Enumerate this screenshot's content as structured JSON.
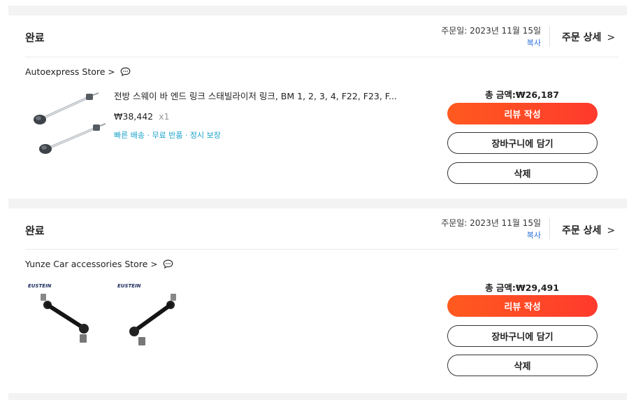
{
  "orders": [
    {
      "status": "완료",
      "order_date": "주문일: 2023년 11월 15일",
      "copy_label": "복사",
      "detail_label": "주문 상세",
      "detail_chevron": ">",
      "store_name": "Autoexpress Store",
      "store_chevron": ">",
      "product_title": "전방 스웨이 바 엔드 링크 스태빌라이저 링크, BM 1, 2, 3, 4, F22, F23, F...",
      "price": "₩38,442",
      "quantity": "x1",
      "benefits": "빠른 배송 · 무료 반품 · 정시 보장",
      "total": "총 금액:₩26,187",
      "review_label": "리뷰 작성",
      "cart_label": "장바구니에 담기",
      "delete_label": "삭제"
    },
    {
      "status": "완료",
      "order_date": "주문일: 2023년 11월 15일",
      "copy_label": "복사",
      "detail_label": "주문 상세",
      "detail_chevron": ">",
      "store_name": "Yunze Car accessories Store",
      "store_chevron": ">",
      "image_brand": "EUSTEIN",
      "total": "총 금액:₩29,491",
      "review_label": "리뷰 작성",
      "cart_label": "장바구니에 담기",
      "delete_label": "삭제"
    }
  ],
  "colors": {
    "accent": "#ff4a24",
    "link": "#2a6fdb",
    "benefit": "#1aa3c9",
    "band": "#f3f3f3"
  },
  "icons": [
    "chat-icon",
    "chevron-right-icon"
  ]
}
